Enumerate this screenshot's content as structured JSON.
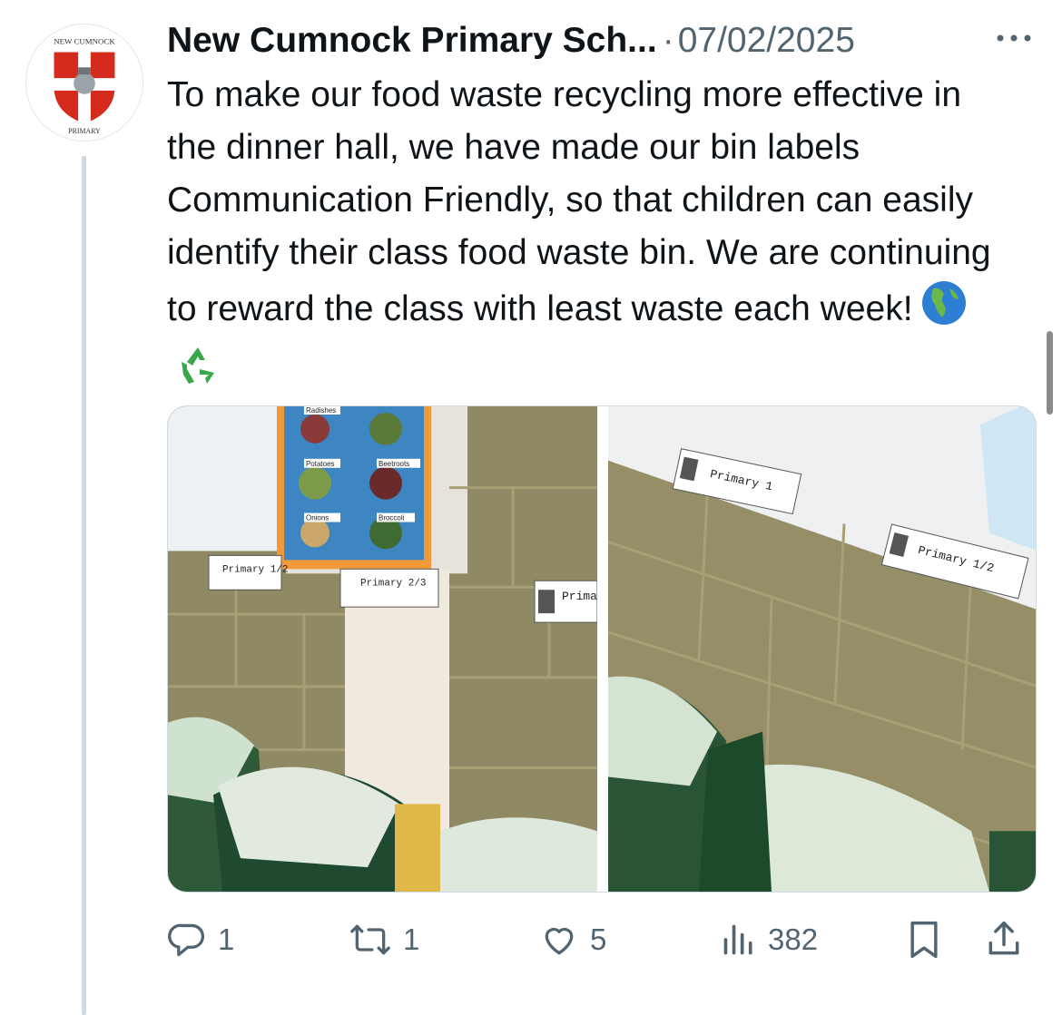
{
  "post": {
    "author_name": "New Cumnock Primary Sch...",
    "separator": "·",
    "date": "07/02/2025",
    "text": "To make our food waste recycling more effective in the dinner hall, we have made our bin labels Communication Friendly, so that children can easily identify their class food waste bin. We are continuing to reward the class with least waste each week!",
    "emojis": [
      "globe-americas",
      "recycling-symbol"
    ]
  },
  "avatar": {
    "crest_top_text": "NEW CUMNOCK",
    "crest_bottom_text": "PRIMARY"
  },
  "media": {
    "left_photo": {
      "poster_labels": [
        "Radishes",
        "Potatoes",
        "Beetroots",
        "Onions",
        "Broccoli"
      ],
      "bin_labels": [
        "Primary 1/2",
        "Primary 2/3",
        "Prima"
      ]
    },
    "right_photo": {
      "bin_labels": [
        "Primary 1",
        "Primary 1/2"
      ]
    }
  },
  "actions": {
    "replies": "1",
    "reposts": "1",
    "likes": "5",
    "views": "382"
  },
  "colors": {
    "text": "#0f1419",
    "secondary": "#536471",
    "thread_line": "#cfd9de",
    "crest_red": "#d52b1e"
  },
  "icons": {
    "more": "more-dots-icon",
    "reply": "reply-icon",
    "repost": "repost-icon",
    "like": "heart-icon",
    "views": "views-chart-icon",
    "bookmark": "bookmark-icon",
    "share": "share-icon"
  }
}
